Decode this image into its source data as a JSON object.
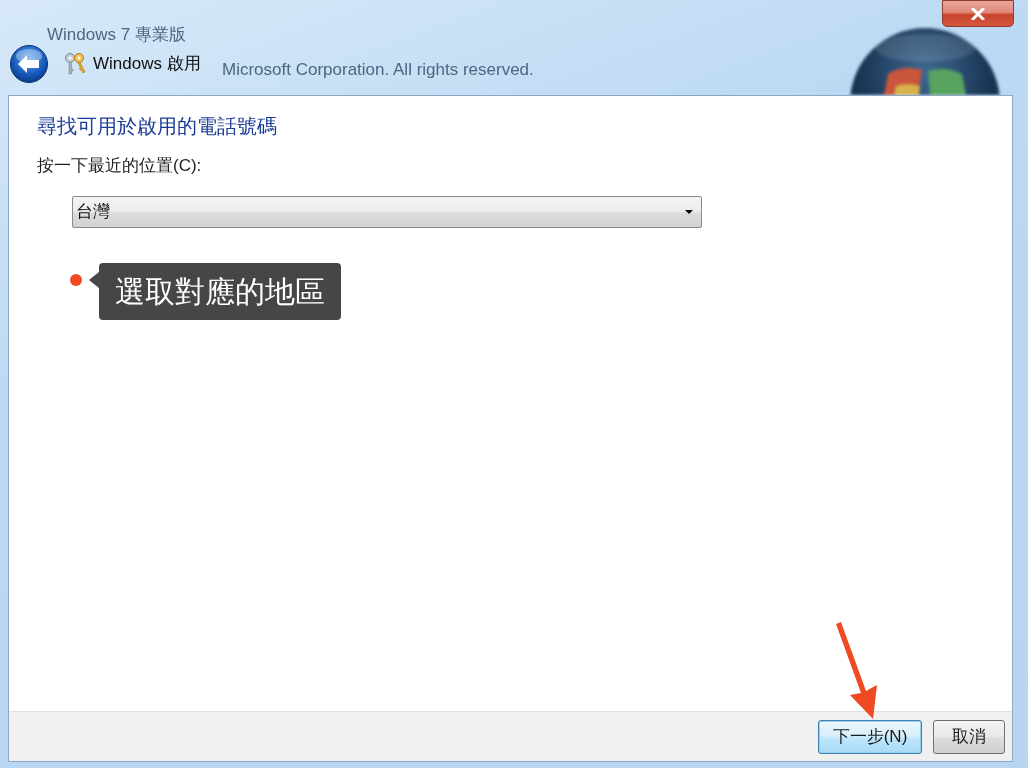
{
  "background_text": [
    "Windows 7 專業版",
    "Microsoft Corporation. All rights reserved."
  ],
  "window": {
    "title": "Windows 啟用"
  },
  "page": {
    "heading": "尋找可用於啟用的電話號碼",
    "location_label": "按一下最近的位置(C):",
    "location_select": {
      "value": "台灣"
    }
  },
  "annotation": {
    "callout": "選取對應的地區"
  },
  "buttons": [
    {
      "label": "下一步(N)",
      "focused": true
    },
    {
      "label": "取消",
      "focused": false
    }
  ]
}
